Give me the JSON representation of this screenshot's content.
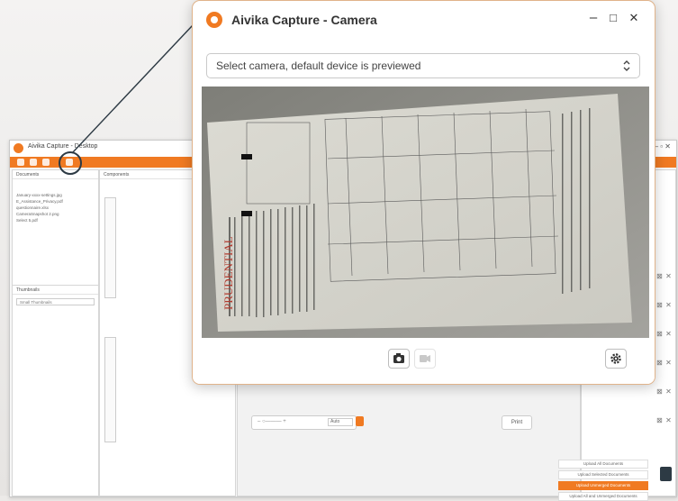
{
  "background_app": {
    "title": "Aivika Capture - Desktop",
    "panels": {
      "documents_header": "Documents",
      "components_header": "Components",
      "thumbnails_header": "Thumbnails",
      "thumbnail_select": "Small Thumbnails"
    },
    "documents": [
      "January-xxxx-settings.jpg",
      "E_Assistance_Privacy.pdf",
      "questionnaire.xlsx",
      "CameraSnapshot 2.png",
      "Select 5.pdf"
    ],
    "zoom_value": "Auto",
    "print_label": "Print",
    "upload_options": [
      "Upload All Documents",
      "Upload Selected Documents",
      "Upload Unmerged Documents",
      "Upload All and Unmerged Documents"
    ]
  },
  "dialog": {
    "title": "Aivika Capture - Camera",
    "minimize": "–",
    "maximize": "□",
    "close": "✕",
    "camera_select": {
      "selected": "Select camera, default device is previewed"
    },
    "document_heading": "PRUDENTIAL",
    "buttons": {
      "snapshot_icon": "camera-icon",
      "video_icon": "video-icon",
      "settings_icon": "gear-icon"
    }
  },
  "colors": {
    "accent": "#f07a22",
    "callout": "#2d3a44"
  }
}
